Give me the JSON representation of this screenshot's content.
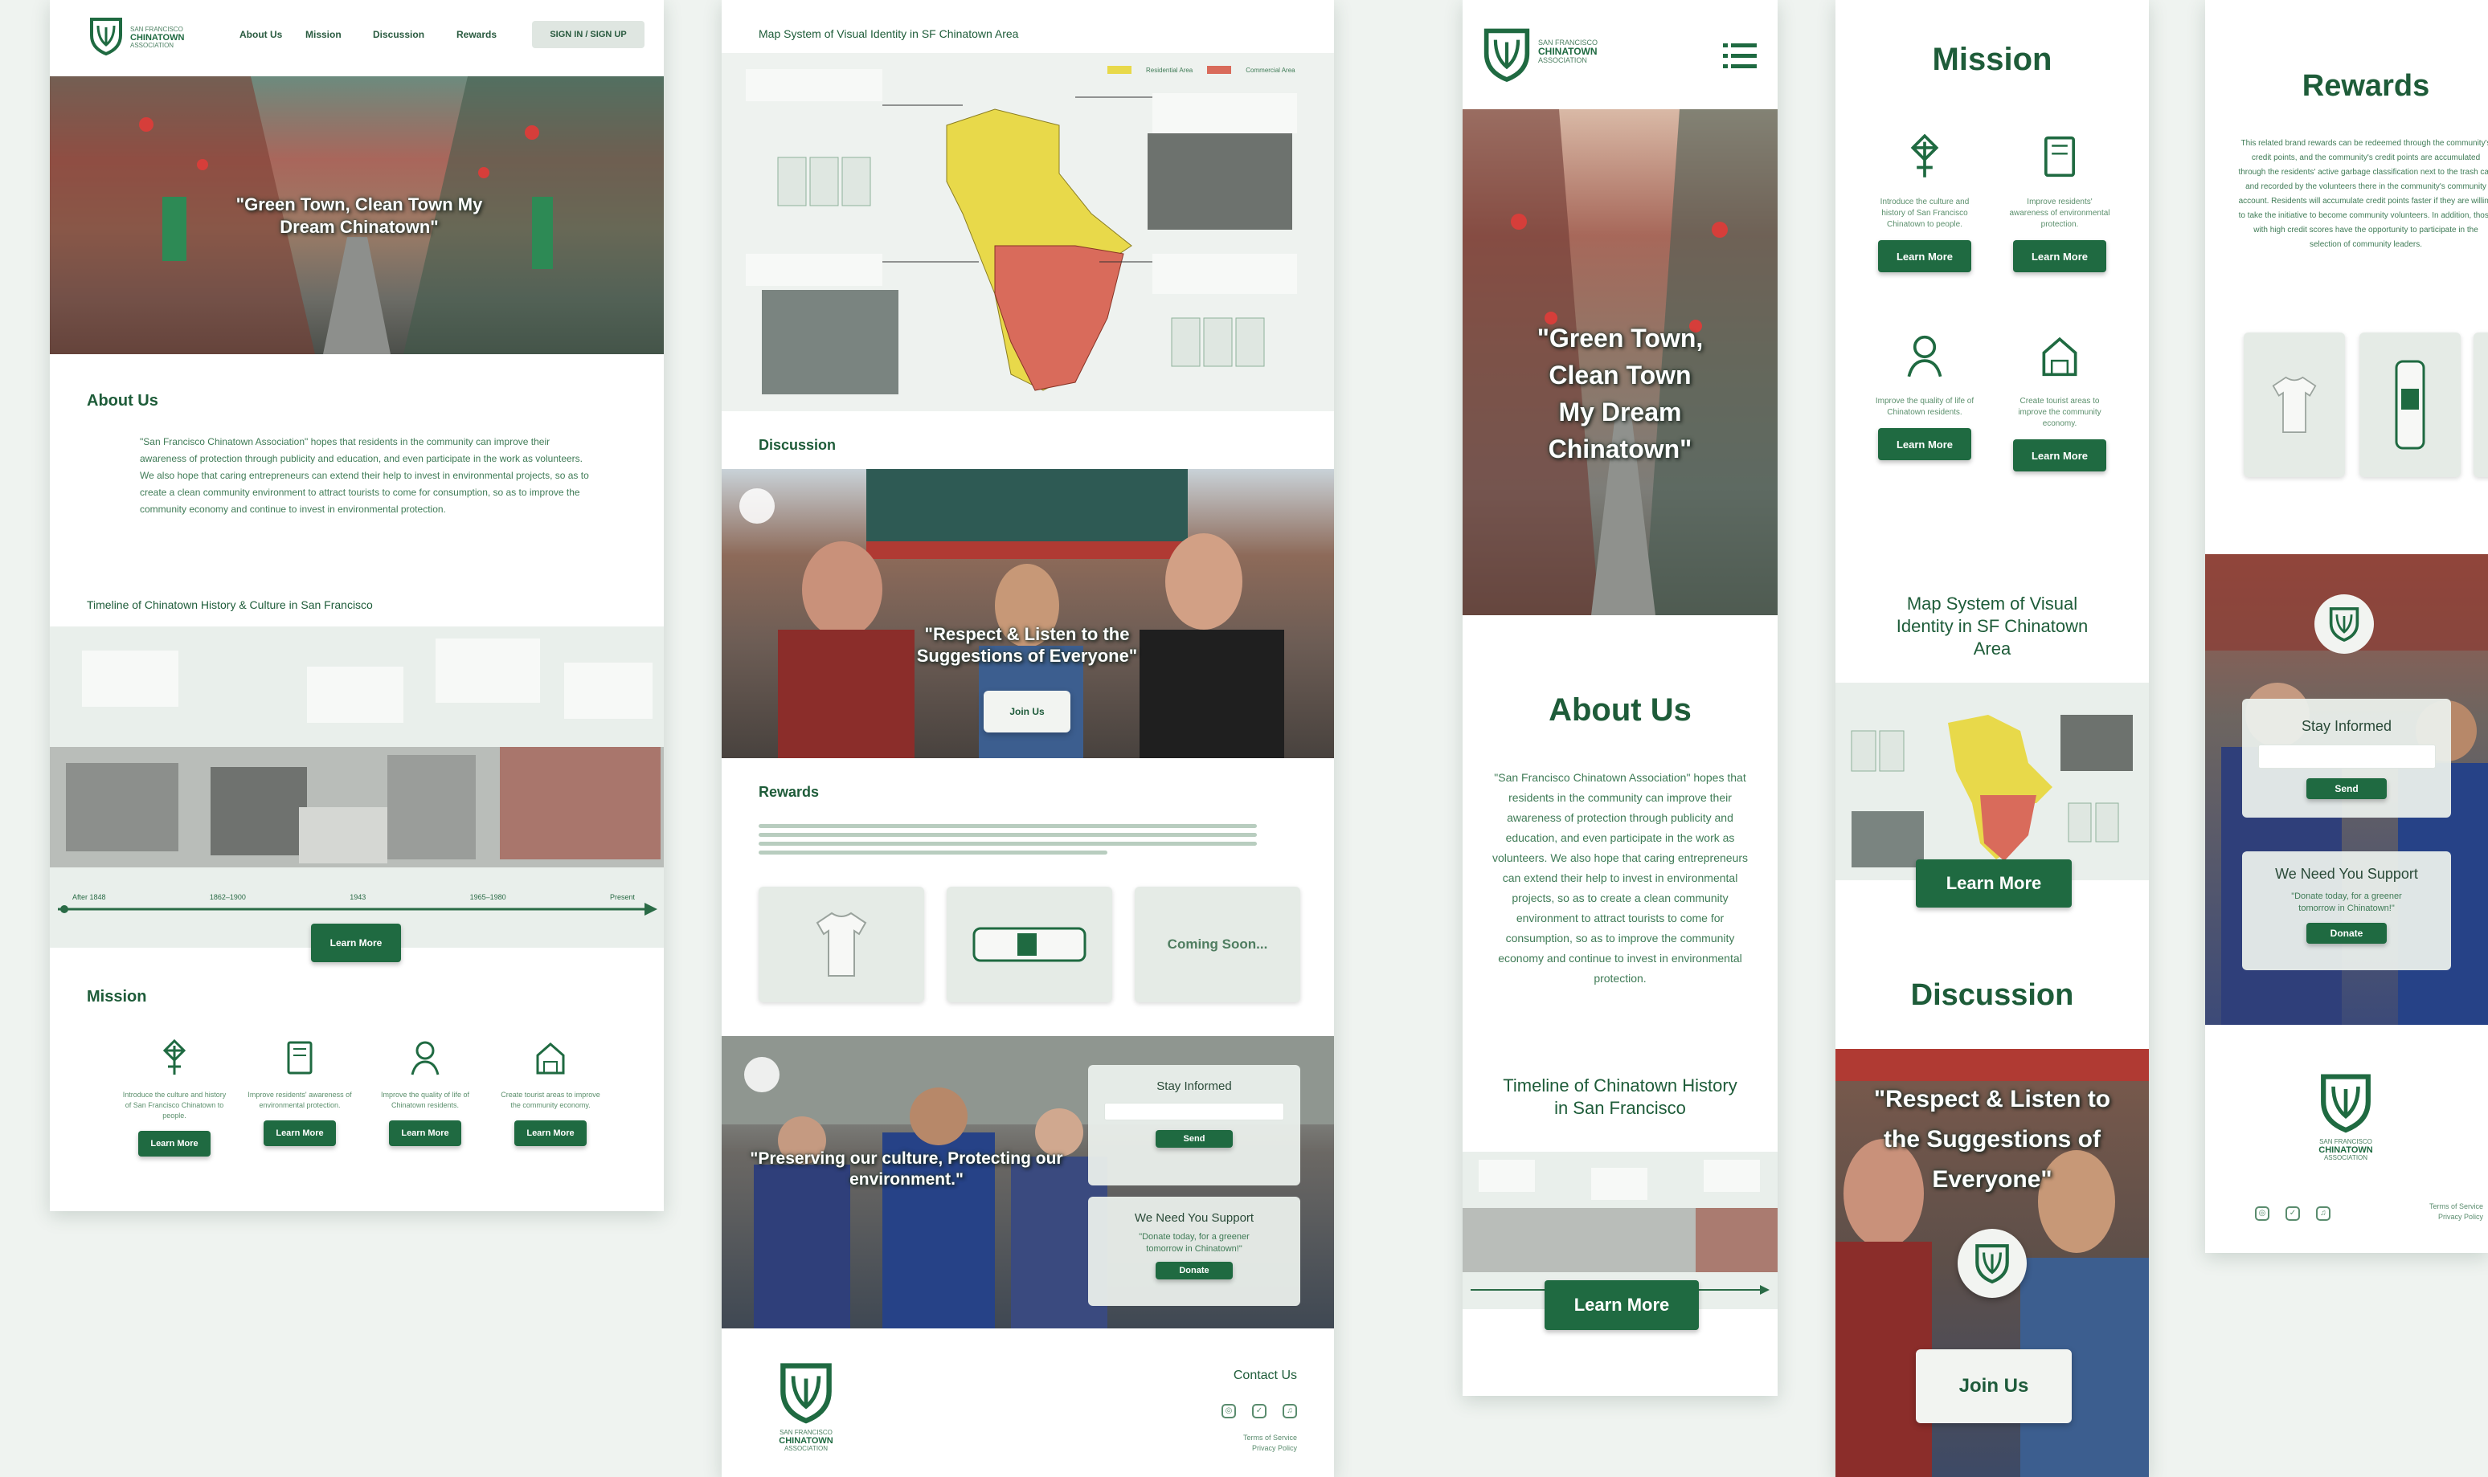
{
  "brand": {
    "name_line1": "SAN FRANCISCO",
    "name_line2": "CHINATOWN",
    "name_line3": "ASSOCIATION",
    "colors": {
      "primary": "#1f6a41",
      "background": "#eff3f0",
      "accent_yellow": "#e8d94a",
      "accent_red": "#d96b5b"
    }
  },
  "desktop": {
    "nav": {
      "items": [
        "About Us",
        "Mission",
        "Discussion",
        "Rewards"
      ],
      "sign_in": "SIGN IN / SIGN UP"
    },
    "hero": {
      "quote": "\"Green Town, Clean Town My Dream Chinatown\""
    },
    "about": {
      "title": "About Us",
      "text": "\"San Francisco Chinatown Association\" hopes that residents in the community can improve their awareness of protection through publicity and education, and even participate in the work as volunteers. We also hope that caring entrepreneurs can extend their help to invest in environmental projects, so as to create a clean community environment to attract tourists to come for consumption, so as to improve the community economy and continue to invest in environmental protection."
    },
    "timeline": {
      "title": "Timeline of Chinatown History & Culture in San Francisco",
      "dates": [
        "After 1848",
        "1862–1900",
        "1943",
        "1965–1980",
        "Present"
      ],
      "learn_more": "Learn More"
    },
    "mission": {
      "title": "Mission",
      "items": [
        {
          "icon": "knot-icon",
          "desc": "Introduce the culture and history of San Francisco Chinatown to people.",
          "button": "Learn More"
        },
        {
          "icon": "book-icon",
          "desc": "Improve residents' awareness of environmental protection.",
          "button": "Learn More"
        },
        {
          "icon": "person-icon",
          "desc": "Improve the quality of life of Chinatown residents.",
          "button": "Learn More"
        },
        {
          "icon": "house-icon",
          "desc": "Create tourist areas to improve the community economy.",
          "button": "Learn More"
        }
      ]
    }
  },
  "desktop2": {
    "map": {
      "title": "Map System of Visual Identity in SF Chinatown Area",
      "legend": [
        "Residential Area",
        "Commercial Area"
      ]
    },
    "discussion": {
      "title": "Discussion",
      "quote": "\"Respect & Listen to the Suggestions of Everyone\"",
      "join": "Join Us"
    },
    "rewards": {
      "title": "Rewards",
      "coming_soon": "Coming Soon..."
    },
    "banner": {
      "quote": "\"Preserving our culture, Protecting our environment.\"",
      "stay_informed": "Stay Informed",
      "send": "Send",
      "support_title": "We Need You Support",
      "support_text": "\"Donate today, for a greener tomorrow in Chinatown!\"",
      "donate": "Donate"
    },
    "footer": {
      "contact": "Contact Us",
      "terms": "Terms of Service",
      "privacy": "Privacy Policy"
    }
  },
  "mobile1": {
    "hero": {
      "line1": "\"Green Town,",
      "line2": "Clean Town",
      "line3": "My Dream",
      "line4": "Chinatown\""
    },
    "about": {
      "title": "About Us",
      "text": "\"San Francisco Chinatown Association\" hopes that residents in the community can improve their awareness of protection through publicity and education, and even participate in the work as volunteers. We also hope that caring entrepreneurs can extend their help to invest in environmental projects, so as to create a clean community environment to attract tourists to come for consumption, so as to improve the community economy and continue to invest in environmental protection."
    },
    "timeline": {
      "title": "Timeline of Chinatown History in San Francisco",
      "button": "Learn More"
    }
  },
  "mobile2": {
    "mission": {
      "title": "Mission",
      "items": [
        {
          "icon": "knot-icon",
          "desc": "Introduce the culture and history of San Francisco Chinatown to people.",
          "button": "Learn More"
        },
        {
          "icon": "book-icon",
          "desc": "Improve residents' awareness of environmental protection.",
          "button": "Learn More"
        },
        {
          "icon": "person-icon",
          "desc": "Improve the quality of life of Chinatown residents.",
          "button": "Learn More"
        },
        {
          "icon": "house-icon",
          "desc": "Create tourist areas to improve the community economy.",
          "button": "Learn More"
        }
      ]
    },
    "map": {
      "title": "Map System of Visual Identity in SF Chinatown Area",
      "button": "Learn More"
    },
    "discussion": {
      "title": "Discussion",
      "quote": "\"Respect & Listen to the Suggestions of Everyone\"",
      "join": "Join Us"
    }
  },
  "mobile3": {
    "rewards": {
      "title": "Rewards",
      "text": "This related brand rewards can be redeemed through the community's credit points, and the community's credit points are accumulated through the residents' active garbage classification next to the trash can and recorded by the volunteers there in the community's community account. Residents will accumulate credit points faster if they are willing to take the initiative to become community volunteers. In addition, those with high credit scores have the opportunity to participate in the selection of community leaders."
    },
    "stay_informed": "Stay Informed",
    "send": "Send",
    "support_title": "We Need You Support",
    "support_text": "\"Donate today, for a greener tomorrow in Chinatown!\"",
    "donate": "Donate",
    "footer": {
      "terms": "Terms of Service",
      "privacy": "Privacy Policy"
    }
  }
}
